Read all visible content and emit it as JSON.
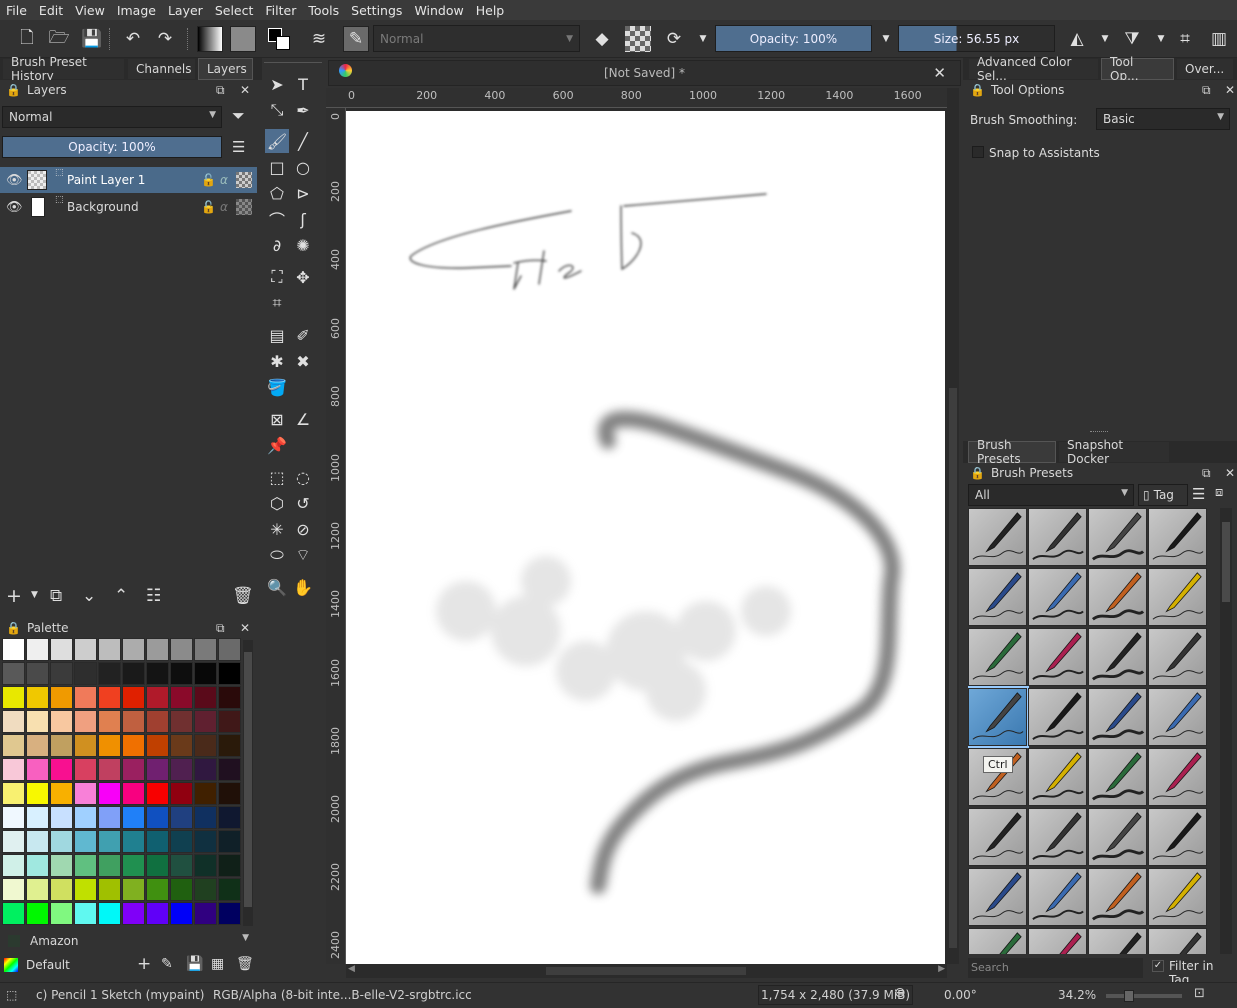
{
  "menu": [
    "File",
    "Edit",
    "View",
    "Image",
    "Layer",
    "Select",
    "Filter",
    "Tools",
    "Settings",
    "Window",
    "Help"
  ],
  "toolbar": {
    "blend_mode": "Normal",
    "opacity": "Opacity: 100%",
    "size": "Size: 56.55 px"
  },
  "left_tabs": [
    "Brush Preset History",
    "Channels",
    "Layers"
  ],
  "layers_docker": {
    "title": "Layers",
    "blend_mode": "Normal",
    "opacity": "Opacity:  100%",
    "layers": [
      {
        "name": "Paint Layer 1",
        "selected": true
      },
      {
        "name": "Background",
        "selected": false
      }
    ]
  },
  "palette": {
    "title": "Palette",
    "set_name": "Amazon",
    "default_label": "Default",
    "rows": [
      [
        "#ffffff",
        "#efefef",
        "#dedede",
        "#cdcdcd",
        "#bdbdbd",
        "#acacac",
        "#9b9b9b",
        "#8b8b8b",
        "#7a7a7a",
        "#6a6a6a"
      ],
      [
        "#595959",
        "#4a4a4a",
        "#3b3b3b",
        "#2e2e2e",
        "#222222",
        "#1a1a1a",
        "#141414",
        "#0e0e0e",
        "#080808",
        "#000000"
      ],
      [
        "#e8e800",
        "#f0c800",
        "#f09a00",
        "#f07a5a",
        "#f04020",
        "#e02000",
        "#b01a2a",
        "#8a0a2a",
        "#5a0a1a",
        "#2a0a0a"
      ],
      [
        "#f0dcc0",
        "#f8e0b0",
        "#f8c8a0",
        "#f0a080",
        "#e08050",
        "#c06040",
        "#a04030",
        "#703030",
        "#602030",
        "#401818"
      ],
      [
        "#e0c890",
        "#d8b080",
        "#c0a060",
        "#d09020",
        "#f09000",
        "#f07000",
        "#c04000",
        "#6a3a1a",
        "#4a2a1a",
        "#2a1a0a"
      ],
      [
        "#f8c8d8",
        "#f860c0",
        "#f81090",
        "#d84060",
        "#c04060",
        "#9a2060",
        "#702070",
        "#502050",
        "#301840",
        "#201020"
      ],
      [
        "#f8f070",
        "#f8f800",
        "#f8b000",
        "#f880d8",
        "#f800f8",
        "#f80080",
        "#f80000",
        "#900010",
        "#402000",
        "#201008"
      ],
      [
        "#f0f8ff",
        "#d8f0ff",
        "#c8e0ff",
        "#a0d0ff",
        "#80a0f8",
        "#2080f8",
        "#1050c0",
        "#204080",
        "#103060",
        "#101830"
      ],
      [
        "#e0f0f0",
        "#c8e8f0",
        "#a0d8e0",
        "#60b8d0",
        "#40a0b0",
        "#208090",
        "#106070",
        "#104050",
        "#103040",
        "#102028"
      ],
      [
        "#d0f0e8",
        "#a0e8e0",
        "#a0d8b0",
        "#60c080",
        "#40a060",
        "#209050",
        "#107040",
        "#205040",
        "#103028",
        "#102018"
      ],
      [
        "#f0f8d0",
        "#e0f090",
        "#d0e060",
        "#c0e000",
        "#a0c000",
        "#80b020",
        "#409010",
        "#206010",
        "#204020",
        "#103018"
      ],
      [
        "#00f060",
        "#00f800",
        "#80f880",
        "#60f8f0",
        "#00f8f8",
        "#8000f8",
        "#6000f8",
        "#0000f8",
        "#300080",
        "#000060"
      ]
    ]
  },
  "canvas": {
    "document_title": "[Not Saved]  *",
    "ruler_h": [
      "0",
      "200",
      "400",
      "600",
      "800",
      "1000",
      "1200",
      "1400",
      "1600"
    ],
    "ruler_v": [
      "0",
      "200",
      "400",
      "600",
      "800",
      "1000",
      "1200",
      "1400",
      "1600",
      "1800",
      "2000",
      "2200",
      "2400"
    ]
  },
  "right_top_tabs": [
    "Advanced Color Sel...",
    "Tool Op...",
    "Over..."
  ],
  "tool_options": {
    "title": "Tool Options",
    "smoothing_label": "Brush Smoothing:",
    "smoothing_value": "Basic",
    "snap_label": "Snap to Assistants"
  },
  "right_bottom_tabs": [
    "Brush Presets",
    "Snapshot Docker"
  ],
  "brush_presets": {
    "title": "Brush Presets",
    "filter": "All",
    "tag_button": "Tag",
    "search_placeholder": "Search",
    "filter_in_tag": "Filter in Tag",
    "tooltip": "Ctrl"
  },
  "status": {
    "brush": "c) Pencil 1 Sketch (mypaint)",
    "color_profile": "RGB/Alpha (8-bit inte...B-elle-V2-srgbtrc.icc",
    "dimensions": "1,754 x 2,480 (37.9 MiB)",
    "rotation": "0.00°",
    "zoom": "34.2%"
  }
}
